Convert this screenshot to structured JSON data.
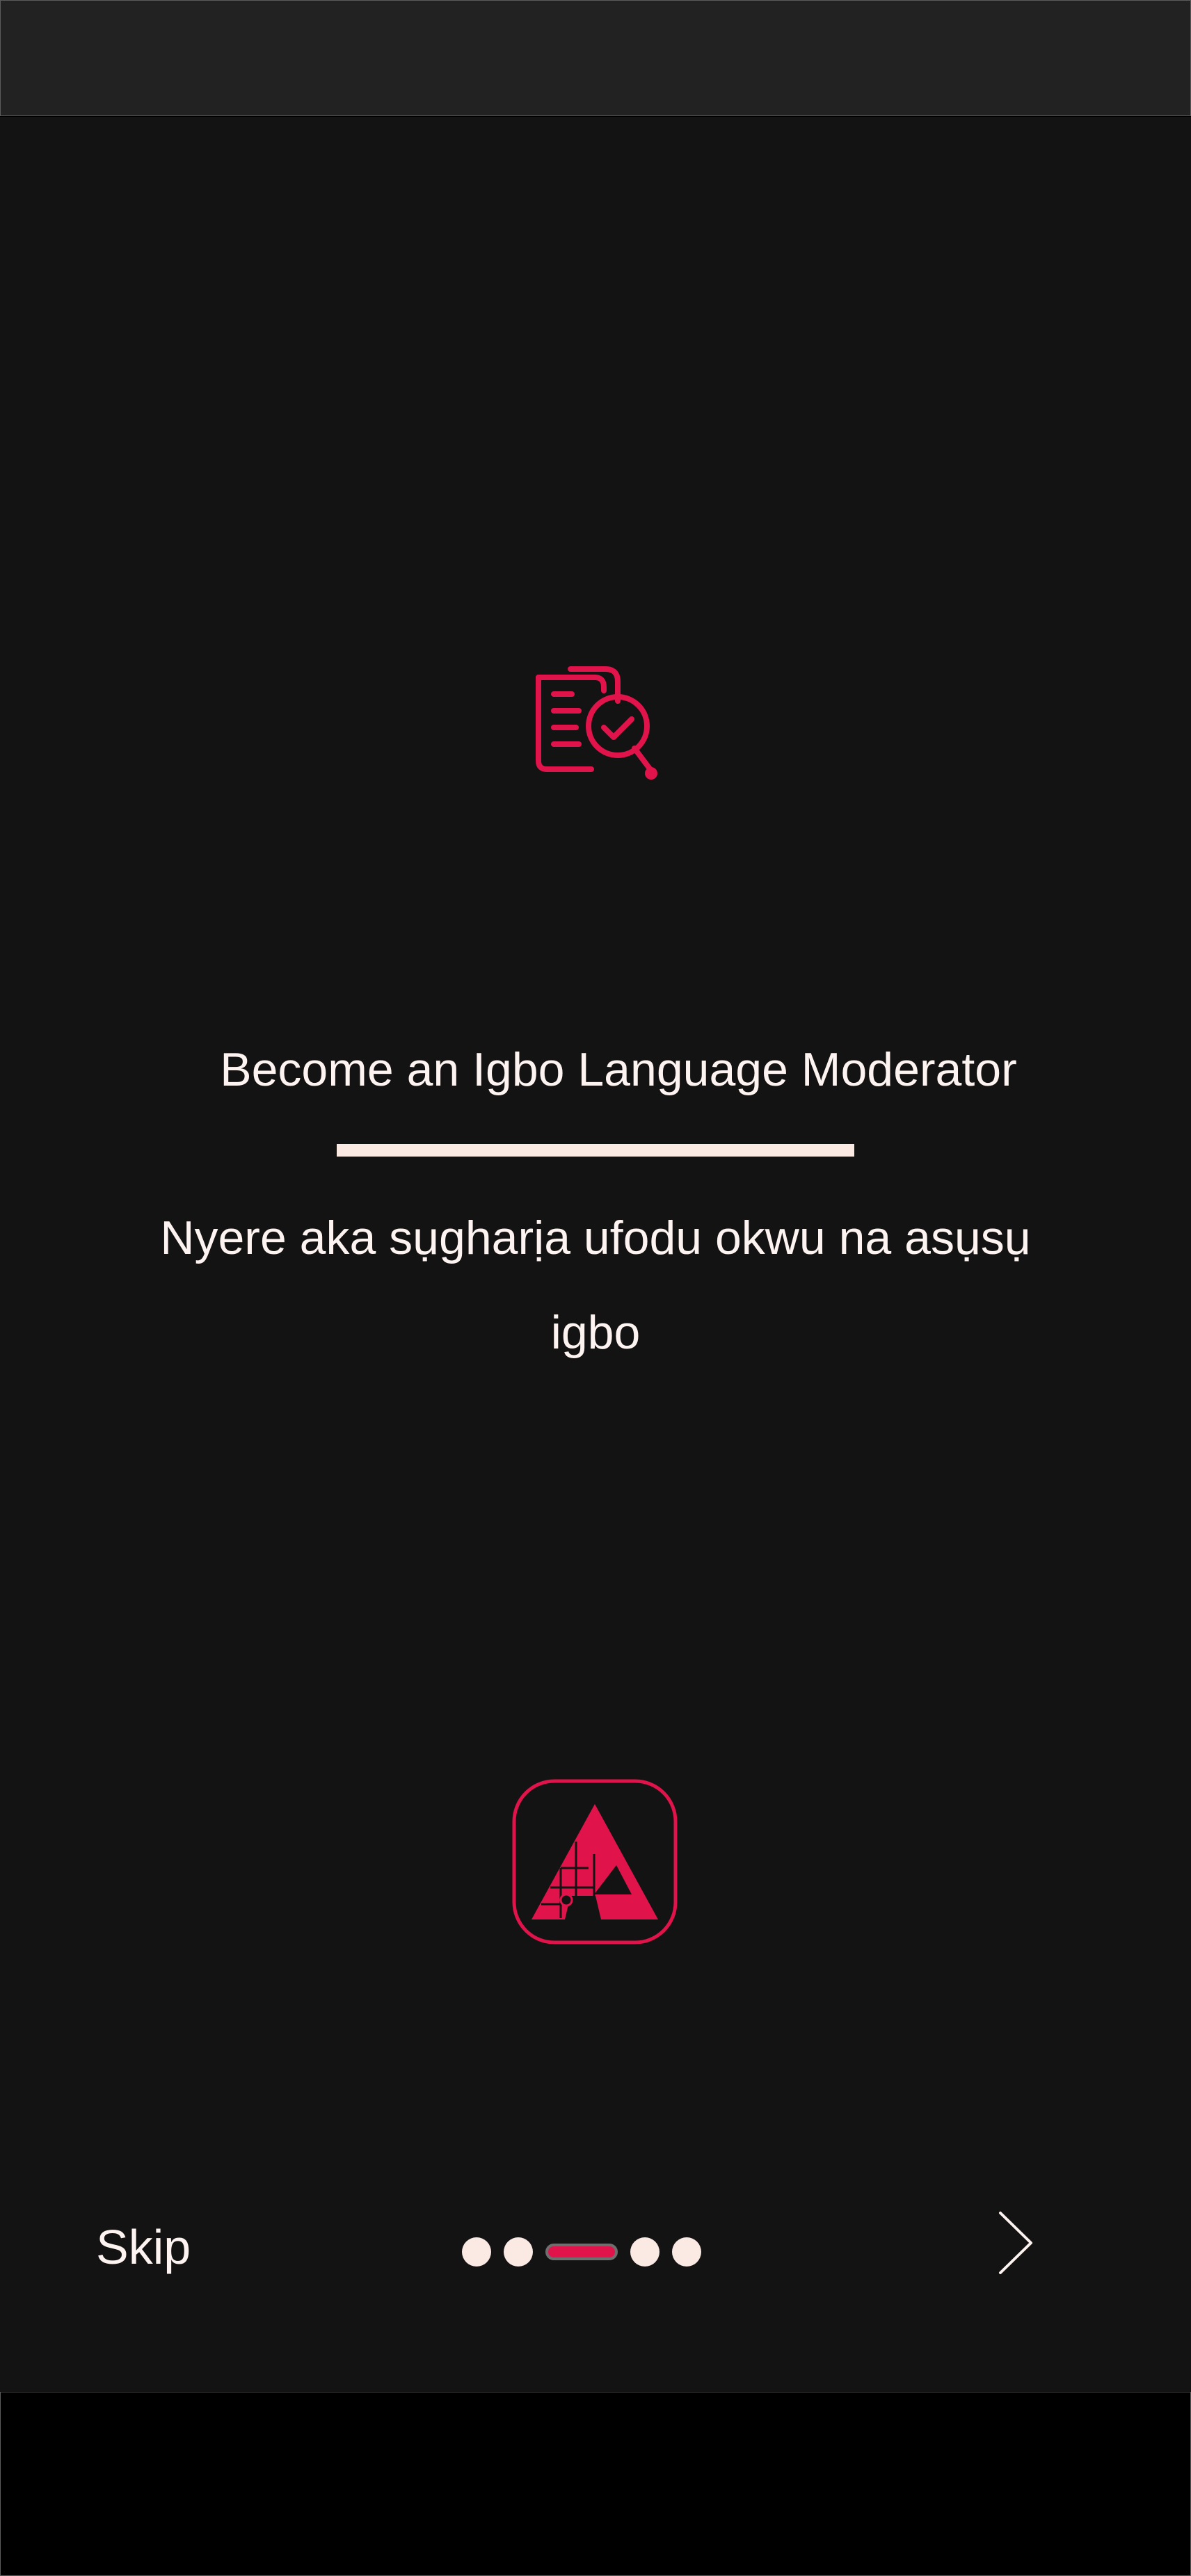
{
  "onboarding": {
    "title": "Become an Igbo Language Moderator",
    "subtitle": "Nyere aka sụgharịa ufodu okwu na asụsụ igbo",
    "skip_label": "Skip",
    "pager": {
      "total": 5,
      "current": 3
    }
  },
  "icons": {
    "feature": "document-review-magnifier-icon",
    "logo": "app-logo-icon",
    "next": "chevron-right-icon"
  },
  "colors": {
    "accent": "#e0134a",
    "background": "#131313",
    "text": "#fdf3f0"
  }
}
